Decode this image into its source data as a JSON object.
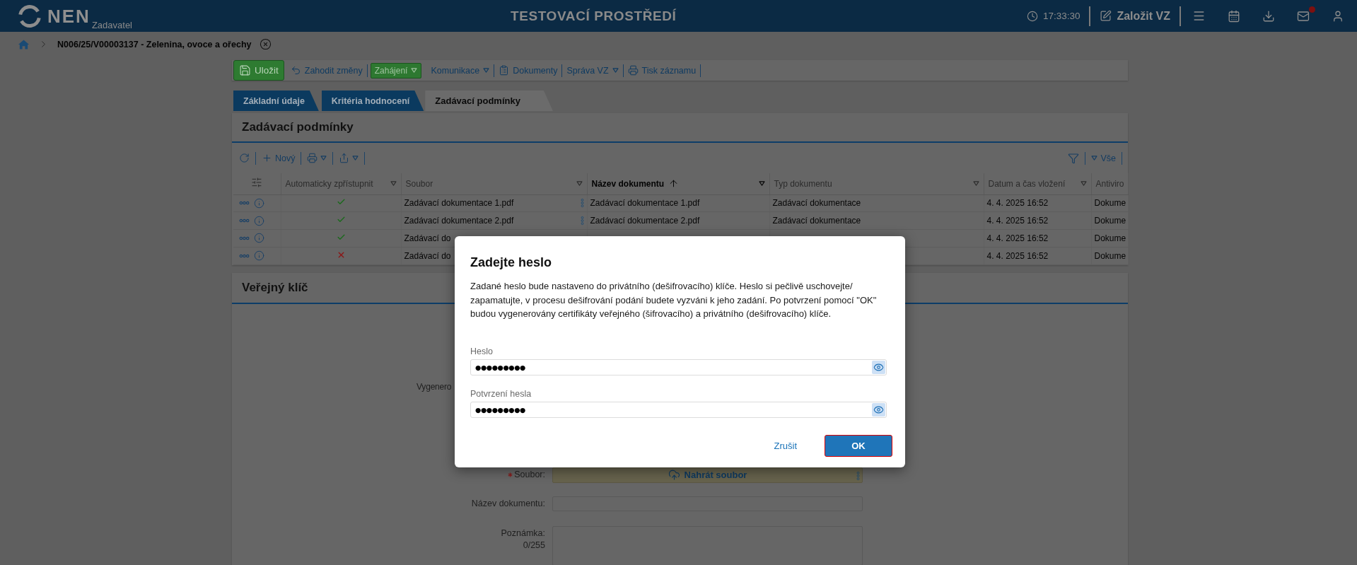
{
  "header": {
    "logo": "NEN",
    "role": "Zadavatel",
    "environment": "TESTOVACÍ PROSTŘEDÍ",
    "time": "17:33:30",
    "create_button": "Založit VZ",
    "mail_unread": true
  },
  "breadcrumb": {
    "title": "N006/25/V00003137 - Zelenina, ovoce a ořechy"
  },
  "toolbar": [
    {
      "kind": "primary",
      "label": "Uložit",
      "menu": false
    },
    {
      "kind": "link",
      "label": "Zahodit změny",
      "menu": false
    },
    {
      "kind": "accent",
      "label": "Zahájení",
      "menu": true
    },
    {
      "kind": "link",
      "label": "Komunikace",
      "menu": true
    },
    {
      "kind": "link",
      "label": "Dokumenty",
      "menu": false
    },
    {
      "kind": "link",
      "label": "Správa VZ",
      "menu": true
    },
    {
      "kind": "link",
      "label": "Tisk záznamu",
      "menu": false
    }
  ],
  "tabs": [
    {
      "label": "Základní údaje",
      "selected": false
    },
    {
      "label": "Kritéria hodnocení",
      "selected": false
    },
    {
      "label": "Zadávací podmínky",
      "selected": true
    }
  ],
  "conditions": {
    "title": "Zadávací podmínky",
    "new_button": "Nový",
    "view_filter": "Vše",
    "columns": [
      {
        "label": "Automaticky zpřístupnit",
        "sorted": false
      },
      {
        "label": "Soubor",
        "sorted": false
      },
      {
        "label": "Název dokumentu",
        "sorted": true
      },
      {
        "label": "Typ dokumentu",
        "sorted": false
      },
      {
        "label": "Datum a čas vložení",
        "sorted": false
      },
      {
        "label": "Antiviro",
        "sorted": false
      }
    ],
    "rows": [
      {
        "auto_publish": true,
        "file": "Zadávací dokumentace 1.pdf",
        "file_actions": true,
        "name": "Zadávací dokumentace 1.pdf",
        "type": "Zadávací dokumentace",
        "date": "4. 4. 2025 16:52",
        "antivirus": "Dokume"
      },
      {
        "auto_publish": true,
        "file": "Zadávací dokumentace 2.pdf",
        "file_actions": true,
        "name": "Zadávací dokumentace 2.pdf",
        "type": "Zadávací dokumentace",
        "date": "4. 4. 2025 16:52",
        "antivirus": "Dokume"
      },
      {
        "auto_publish": true,
        "file": "Zadávací do",
        "file_actions": false,
        "date": "4. 4. 2025 16:52",
        "antivirus": "Dokume"
      },
      {
        "auto_publish": false,
        "file": "Zadávací do",
        "file_actions": false,
        "date": "4. 4. 2025 16:52",
        "antivirus": "Dokume"
      }
    ]
  },
  "public_key": {
    "title": "Veřejný klíč",
    "form": [
      {
        "kind": "covered",
        "label": "Vygenero"
      },
      {
        "kind": "upload",
        "label": "Soubor:",
        "required": true,
        "button": "Nahrát soubor"
      },
      {
        "kind": "input",
        "label": "Název dokumentu:",
        "required": false
      },
      {
        "kind": "textarea",
        "label": "Poznámka:",
        "required": false,
        "counter": "0/255"
      }
    ]
  },
  "dialog": {
    "title": "Zadejte heslo",
    "message": "Zadané heslo bude nastaveno do privátního (dešifrovacího) klíče. Heslo si pečlivě uschovejte/ zapamatujte, v procesu dešifrování podání budete vyzváni k jeho zadání. Po potvrzení pomocí \"OK\" budou vygenerovány certifikáty veřejného (šifrovacího) a privátního (dešifrovacího) klíče.",
    "fields": [
      {
        "label": "Heslo",
        "value": "●●●●●●●●●"
      },
      {
        "label": "Potvrzení hesla",
        "value": "●●●●●●●●●"
      }
    ],
    "cancel": "Zrušit",
    "confirm": {
      "label": "OK",
      "focused": true
    }
  }
}
